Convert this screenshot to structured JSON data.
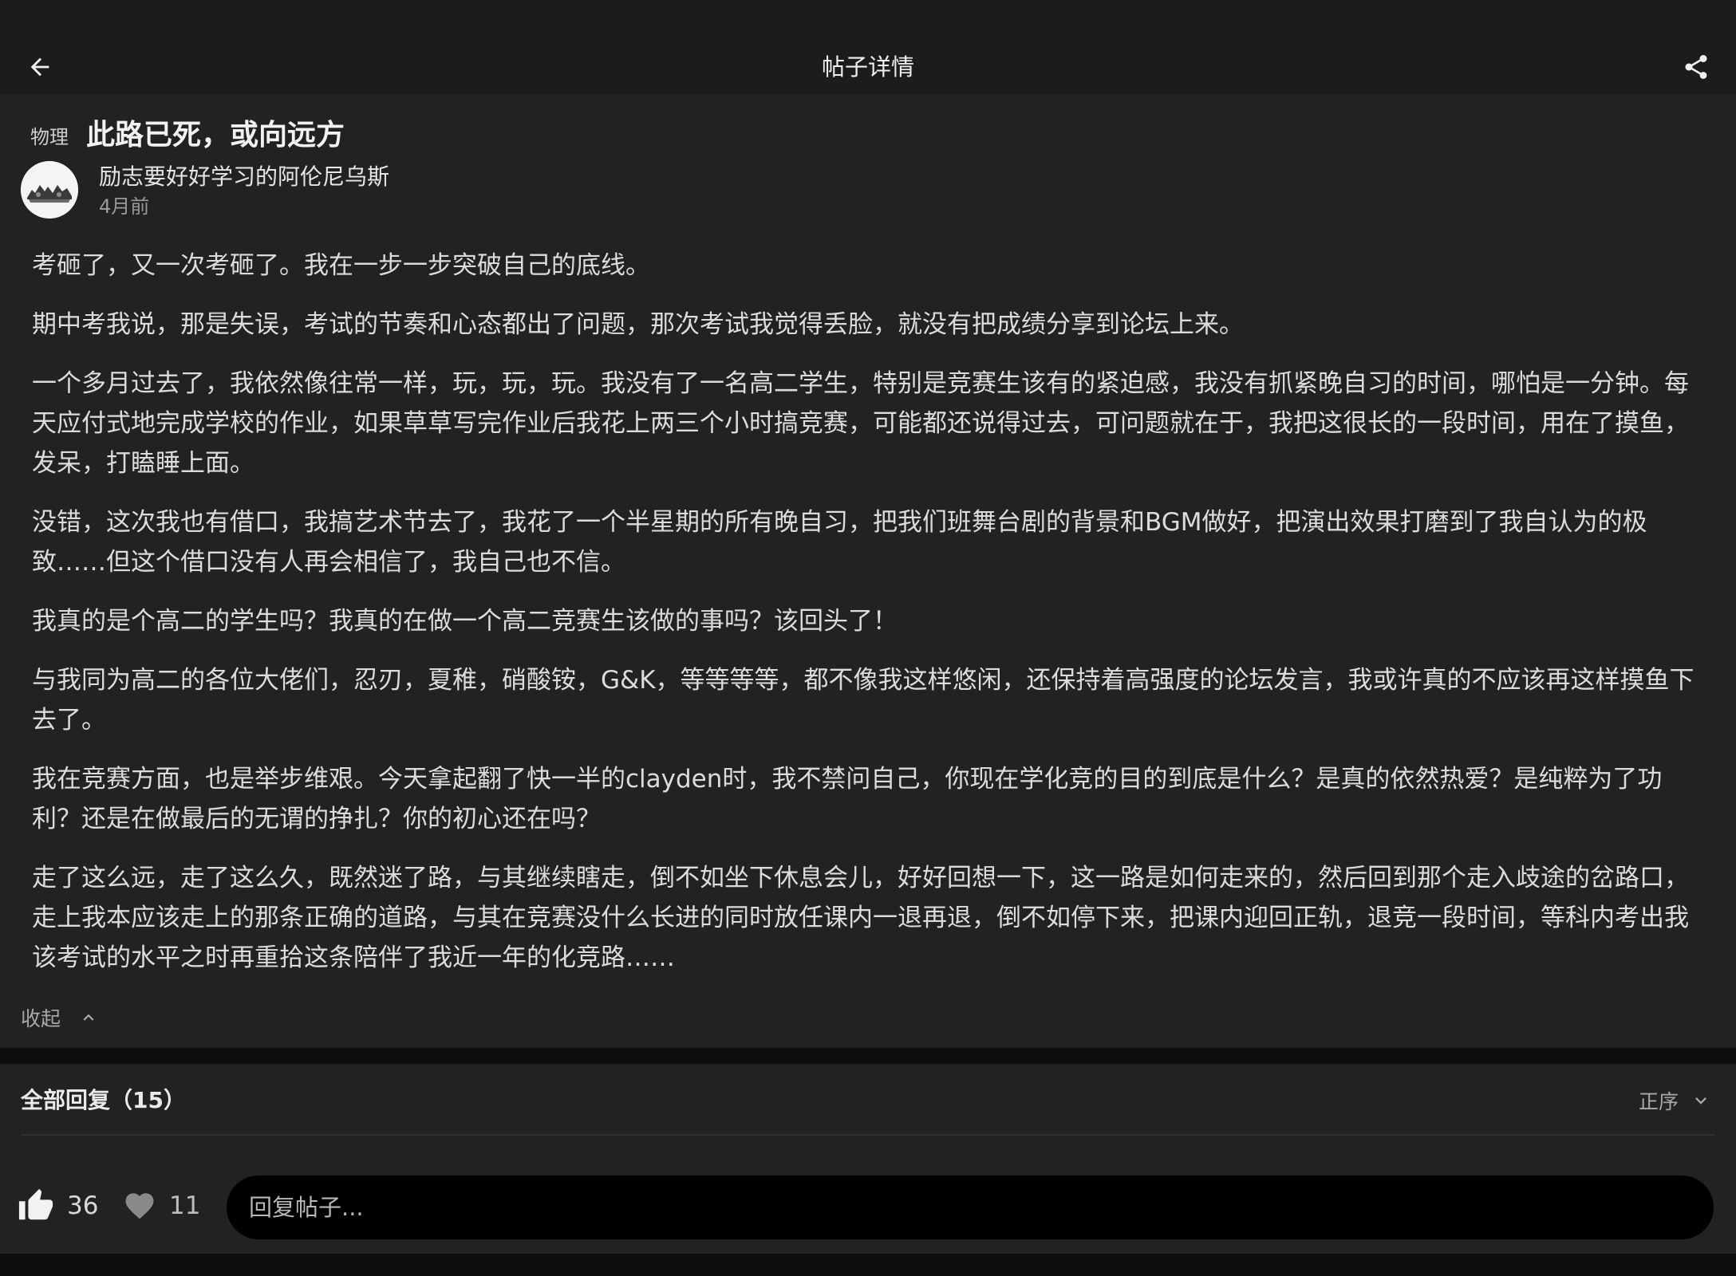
{
  "header": {
    "title": "帖子详情"
  },
  "post": {
    "subject_tag": "物理",
    "title": "此路已死，或向远方",
    "author": "励志要好好学习的阿伦尼乌斯",
    "time": "4月前",
    "paragraphs": [
      "考砸了，又一次考砸了。我在一步一步突破自己的底线。",
      "期中考我说，那是失误，考试的节奏和心态都出了问题，那次考试我觉得丢脸，就没有把成绩分享到论坛上来。",
      "一个多月过去了，我依然像往常一样，玩，玩，玩。我没有了一名高二学生，特别是竞赛生该有的紧迫感，我没有抓紧晚自习的时间，哪怕是一分钟。每天应付式地完成学校的作业，如果草草写完作业后我花上两三个小时搞竞赛，可能都还说得过去，可问题就在于，我把这很长的一段时间，用在了摸鱼，发呆，打瞌睡上面。",
      "没错，这次我也有借口，我搞艺术节去了，我花了一个半星期的所有晚自习，把我们班舞台剧的背景和BGM做好，把演出效果打磨到了我自认为的极致……但这个借口没有人再会相信了，我自己也不信。",
      "我真的是个高二的学生吗？我真的在做一个高二竞赛生该做的事吗？该回头了！",
      "与我同为高二的各位大佬们，忍刃，夏稚，硝酸铵，G&K，等等等等，都不像我这样悠闲，还保持着高强度的论坛发言，我或许真的不应该再这样摸鱼下去了。",
      "我在竞赛方面，也是举步维艰。今天拿起翻了快一半的clayden时，我不禁问自己，你现在学化竞的目的到底是什么？是真的依然热爱？是纯粹为了功利？还是在做最后的无谓的挣扎？你的初心还在吗？",
      "走了这么远，走了这么久，既然迷了路，与其继续瞎走，倒不如坐下休息会儿，好好回想一下，这一路是如何走来的，然后回到那个走入歧途的岔路口，走上我本应该走上的那条正确的道路，与其在竞赛没什么长进的同时放任课内一退再退，倒不如停下来，把课内迎回正轨，退竞一段时间，等科内考出我该考试的水平之时再重拾这条陪伴了我近一年的化竞路……"
    ],
    "collapse_label": "收起"
  },
  "replies": {
    "header": "全部回复（15）",
    "sort_label": "正序"
  },
  "actions": {
    "like_count": "36",
    "favorite_count": "11",
    "reply_placeholder": "回复帖子..."
  },
  "icons": {
    "back": "arrow-left-icon",
    "share": "share-icon",
    "collapse": "chevron-up-icon",
    "sort": "chevron-down-icon",
    "like": "thumbs-up-icon",
    "favorite": "heart-icon"
  },
  "colors": {
    "background": "#121212",
    "topbar": "#1c1c1c",
    "card": "#222222",
    "input": "#000000"
  }
}
